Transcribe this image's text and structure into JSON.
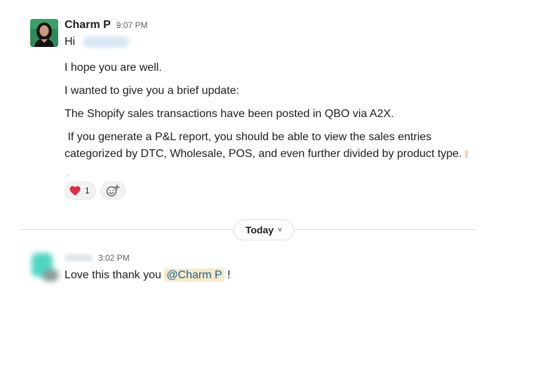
{
  "messages": [
    {
      "author": "Charm P",
      "time": "9:07 PM",
      "greeting": "Hi",
      "paragraphs": [
        "I hope you are well.",
        "I wanted to give you a brief update:",
        "The Shopify sales transactions have been posted in QBO via A2X.",
        " If you generate a P&L report, you should be able to view the sales entries",
        "categorized by DTC, Wholesale, POS, and even further divided by product type."
      ],
      "reactions": [
        {
          "emoji": "❤️",
          "count": "1"
        }
      ],
      "add_reaction_icon": "add-emoji-icon"
    },
    {
      "time": "3:02 PM",
      "text_before": "Love this thank you ",
      "mention": "@Charm P",
      "text_after": " !"
    }
  ],
  "divider": {
    "label": "Today",
    "chevron": "˅"
  },
  "colors": {
    "mention_bg": "#f8e9c6",
    "mention_fg": "#1264a3",
    "heart": "#dd2e44"
  }
}
